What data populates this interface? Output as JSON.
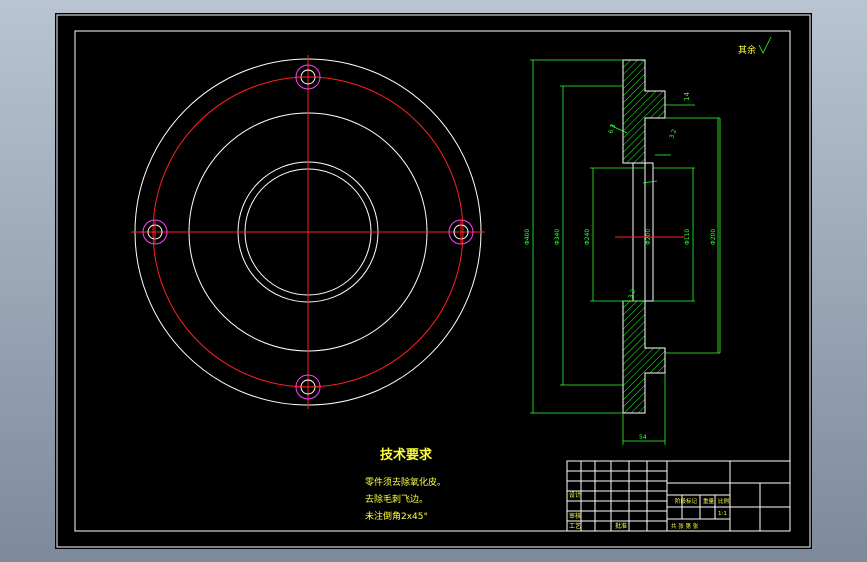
{
  "drawing": {
    "roughness_note": "其余",
    "tech_title": "技术要求",
    "tech_notes": [
      "零件须去除氧化皮。",
      "去除毛刺飞边。",
      "未注倒角2x45°"
    ],
    "dimensions": {
      "right": "14",
      "angle_small": "6.3",
      "angle_small2": "3.2",
      "d_outer": "Φ400",
      "d_bolt": "Φ340",
      "d_bore": "Φ240",
      "d_inner": "Φ200",
      "d_hub": "Φ110",
      "d_hub2": "Φ200",
      "chamfer": "3.2",
      "bottom": "54"
    },
    "title_block": {
      "designer": "设计",
      "check": "审核",
      "process": "工艺",
      "approve": "批准",
      "stage_mark": "阶段标记",
      "weight": "重量",
      "scale": "比例",
      "scale_value": "1:1",
      "sheet": "共 张 第 张"
    }
  }
}
